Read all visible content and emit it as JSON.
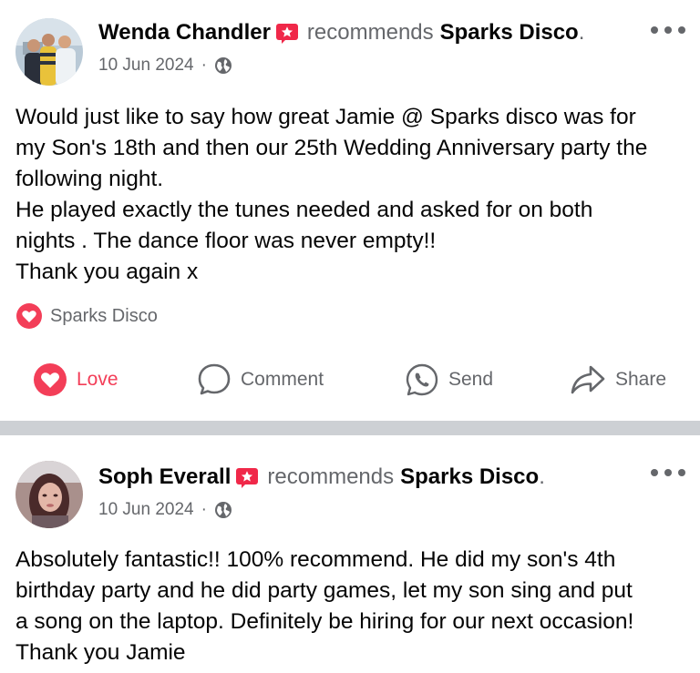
{
  "posts": [
    {
      "author": "Wenda Chandler",
      "action_text": "recommends",
      "page": "Sparks Disco",
      "end_punct": ".",
      "date": "10 Jun 2024",
      "separator": "·",
      "privacy_icon": "globe-icon",
      "body": "Would just like to say how great Jamie @ Sparks disco was for\nmy Son's 18th and then our 25th Wedding Anniversary party the\nfollowing night.\nHe played exactly the tunes needed and asked for on both\nnights . The dance floor was never empty!!\nThank you again x",
      "tag_label": "Sparks Disco",
      "actions": {
        "love": "Love",
        "comment": "Comment",
        "send": "Send",
        "share": "Share"
      }
    },
    {
      "author": "Soph Everall",
      "action_text": "recommends",
      "page": "Sparks Disco",
      "end_punct": ".",
      "date": "10 Jun 2024",
      "separator": "·",
      "privacy_icon": "globe-icon",
      "body": "Absolutely fantastic!! 100% recommend. He did my son's 4th\nbirthday party and he did party games, let my son sing and put\na song on the laptop. Definitely be hiring for our next occasion!\nThank you Jamie"
    }
  ],
  "colors": {
    "text": "#050505",
    "secondary": "#65676b",
    "love": "#f33e58",
    "badge": "#f02849",
    "divider": "#cdd0d4"
  }
}
